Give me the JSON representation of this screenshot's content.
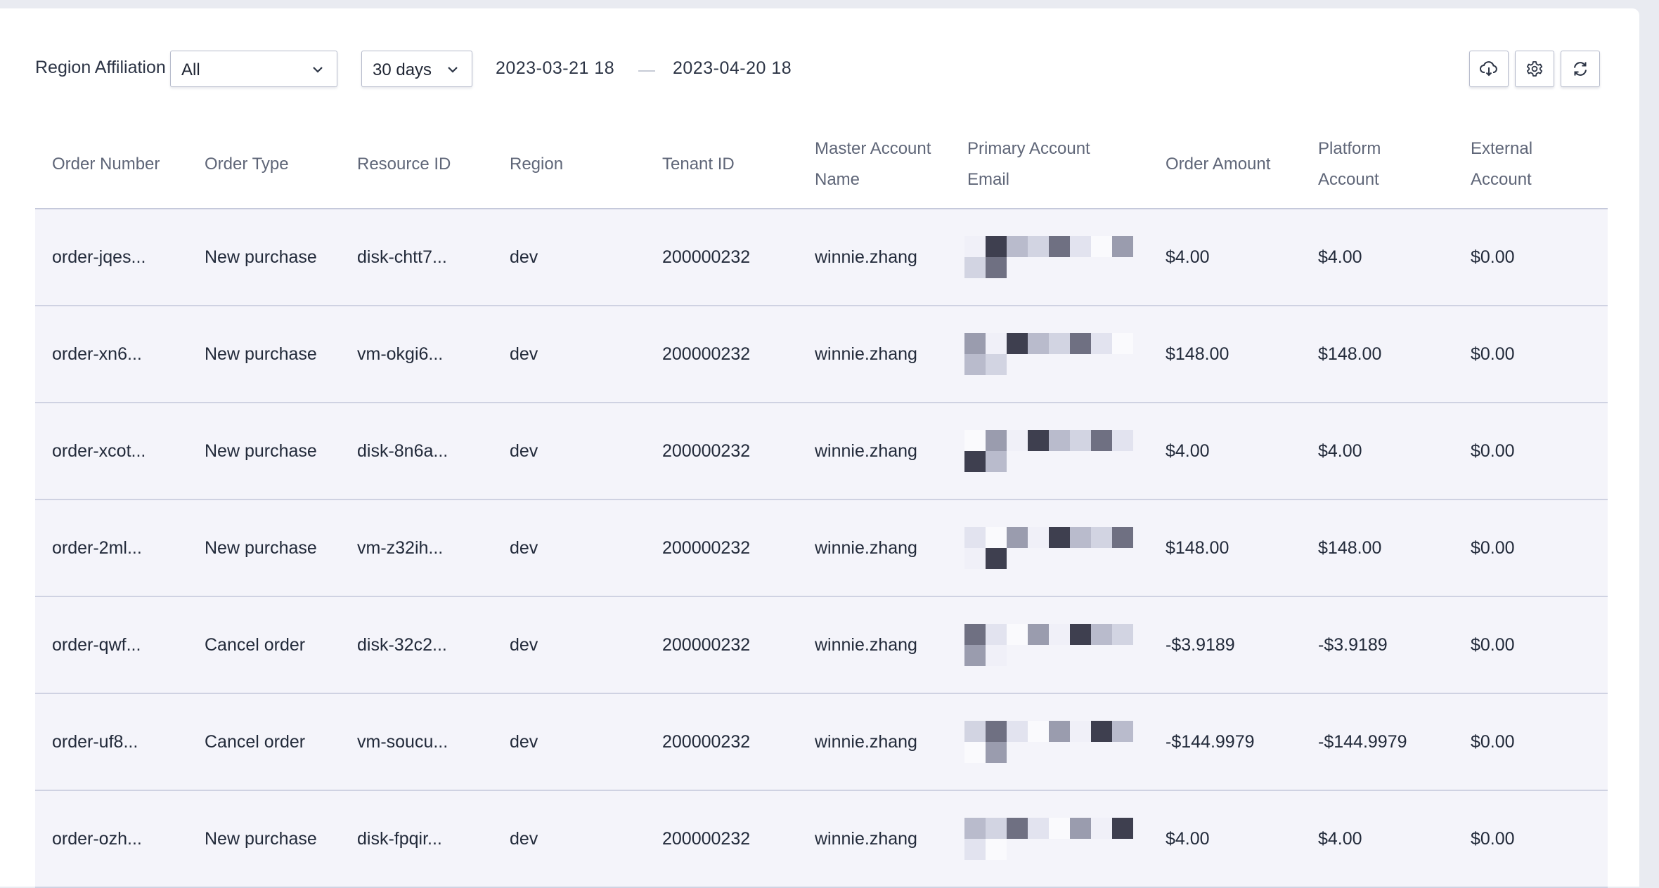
{
  "toolbar": {
    "region_label": "Region Affiliation",
    "region_value": "All",
    "period_value": "30 days",
    "date_start": "2023-03-21 18",
    "date_end": "2023-04-20 18",
    "icons": [
      "cloud-download-icon",
      "gear-icon",
      "refresh-icon"
    ]
  },
  "table": {
    "headers": [
      "Order Number",
      "Order Type",
      "Resource ID",
      "Region",
      "Tenant ID",
      "Master Account Name",
      "Primary Account Email",
      "Order Amount",
      "Platform Account",
      "External Account"
    ],
    "rows": [
      {
        "order": "order-jqes...",
        "type": "New purchase",
        "resource": "disk-chtt7...",
        "region": "dev",
        "tenant": "200000232",
        "master": "winnie.zhang",
        "amount": "$4.00",
        "platform": "$4.00",
        "external": "$0.00"
      },
      {
        "order": "order-xn6...",
        "type": "New purchase",
        "resource": "vm-okgi6...",
        "region": "dev",
        "tenant": "200000232",
        "master": "winnie.zhang",
        "amount": "$148.00",
        "platform": "$148.00",
        "external": "$0.00"
      },
      {
        "order": "order-xcot...",
        "type": "New purchase",
        "resource": "disk-8n6a...",
        "region": "dev",
        "tenant": "200000232",
        "master": "winnie.zhang",
        "amount": "$4.00",
        "platform": "$4.00",
        "external": "$0.00"
      },
      {
        "order": "order-2ml...",
        "type": "New purchase",
        "resource": "vm-z32ih...",
        "region": "dev",
        "tenant": "200000232",
        "master": "winnie.zhang",
        "amount": "$148.00",
        "platform": "$148.00",
        "external": "$0.00"
      },
      {
        "order": "order-qwf...",
        "type": "Cancel order",
        "resource": "disk-32c2...",
        "region": "dev",
        "tenant": "200000232",
        "master": "winnie.zhang",
        "amount": "-$3.9189",
        "platform": "-$3.9189",
        "external": "$0.00"
      },
      {
        "order": "order-uf8...",
        "type": "Cancel order",
        "resource": "vm-soucu...",
        "region": "dev",
        "tenant": "200000232",
        "master": "winnie.zhang",
        "amount": "-$144.9979",
        "platform": "-$144.9979",
        "external": "$0.00"
      },
      {
        "order": "order-ozh...",
        "type": "New purchase",
        "resource": "disk-fpqir...",
        "region": "dev",
        "tenant": "200000232",
        "master": "winnie.zhang",
        "amount": "$4.00",
        "platform": "$4.00",
        "external": "$0.00"
      }
    ]
  }
}
